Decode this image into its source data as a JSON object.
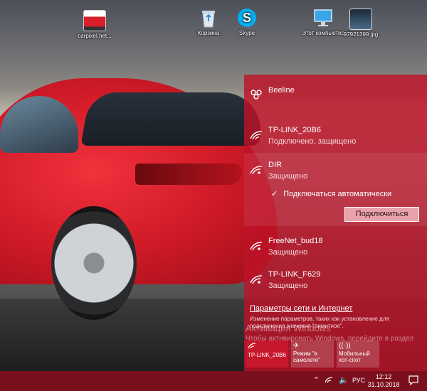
{
  "desktop": {
    "icons": [
      {
        "label": "carpixel.net...",
        "icon": "car-image-icon"
      },
      {
        "label": "Корзина",
        "icon": "recycle-bin-icon"
      },
      {
        "label": "Skype",
        "icon": "skype-icon"
      },
      {
        "label": "Этот компьютер",
        "icon": "this-pc-icon"
      },
      {
        "label": "97921399.jpg",
        "icon": "image-file-icon"
      }
    ]
  },
  "network_flyout": {
    "networks": [
      {
        "name": "Beeline",
        "status": ""
      },
      {
        "name": "TP-LINK_20B6",
        "status": "Подключено, защищено"
      },
      {
        "name": "DIR",
        "status": "Защищено"
      },
      {
        "name": "FreeNet_bud18",
        "status": "Защищено"
      },
      {
        "name": "TP-LINK_F629",
        "status": "Защищено"
      }
    ],
    "auto_connect_label": "Подключаться автоматически",
    "connect_button": "Подключиться",
    "settings_link": "Параметры сети и Интернет",
    "settings_description": "Изменение параметров, таких как установление для подключения значения \"лимитное\".",
    "activation_title": "Активация Windows",
    "activation_text": "Чтобы активировать Windows, перейдите в раздел \"Параметры\".",
    "quick_tiles": [
      {
        "label": "TP-LINK_20B6"
      },
      {
        "label": "Режим \"в самолете\""
      },
      {
        "label": "Мобильный хот-спот"
      }
    ]
  },
  "taskbar": {
    "language": "РУС",
    "time": "12:12",
    "date": "31.10.2018"
  },
  "colors": {
    "accent": "#be1228",
    "taskbar": "#7a0f1d",
    "selected_tile": "#c7172c"
  }
}
